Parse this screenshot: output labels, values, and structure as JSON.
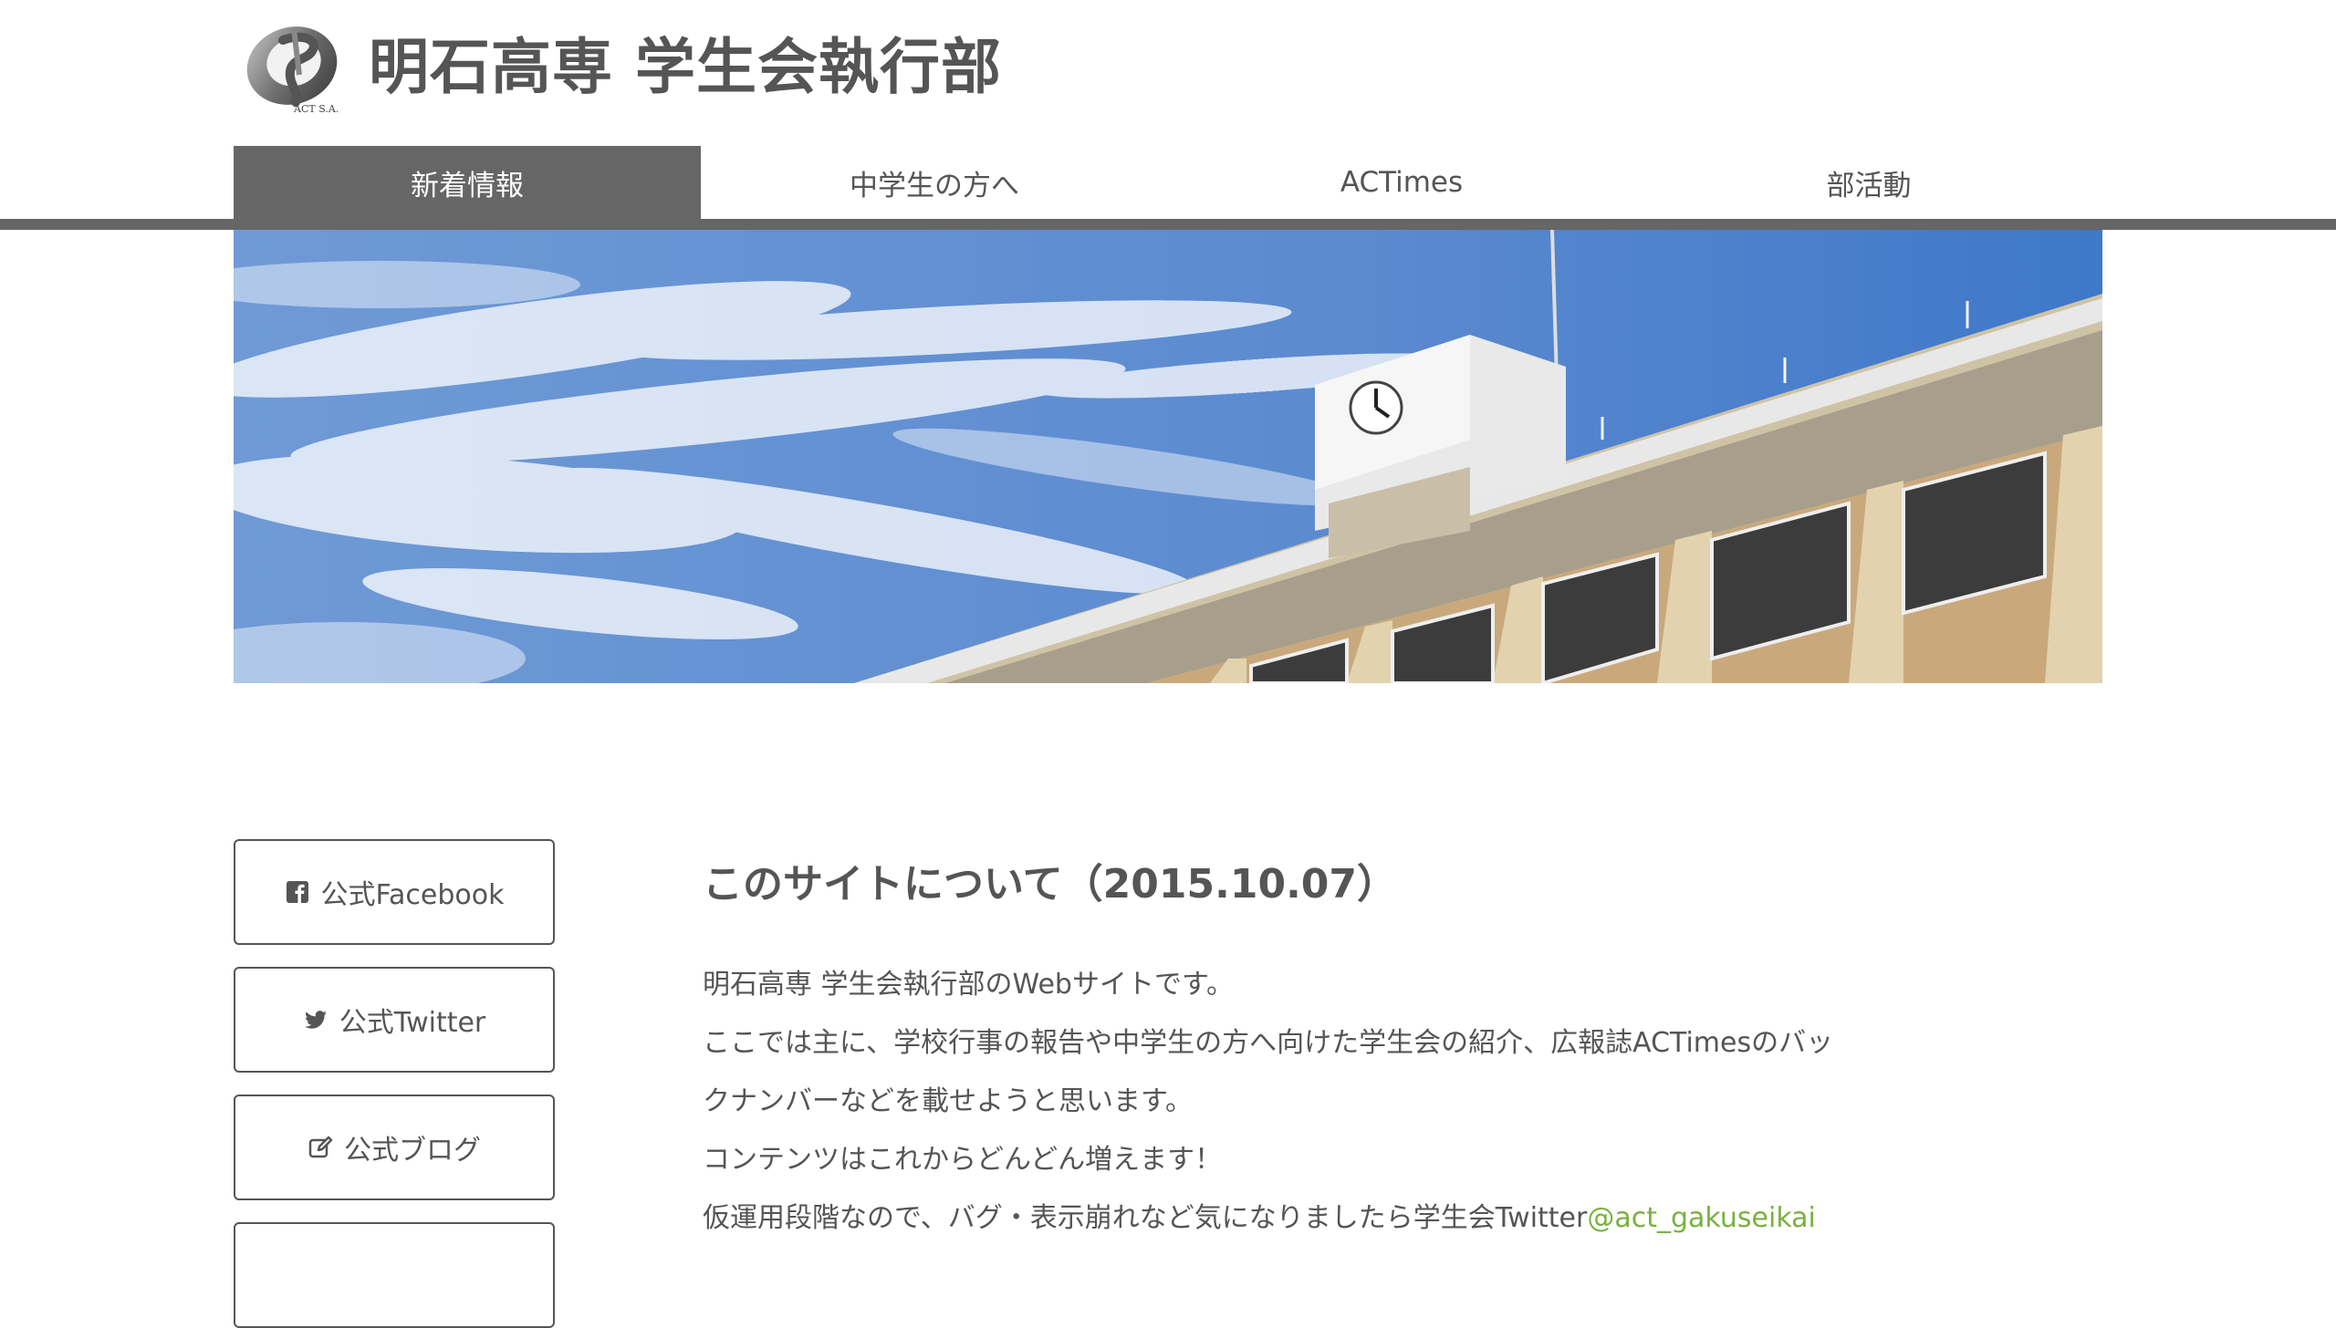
{
  "site": {
    "title": "明石高専 学生会執行部",
    "logo_text": "ACT S.A."
  },
  "nav": {
    "items": [
      {
        "label": "新着情報",
        "active": true
      },
      {
        "label": "中学生の方へ",
        "active": false
      },
      {
        "label": "ACTimes",
        "active": false
      },
      {
        "label": "部活動",
        "active": false
      }
    ]
  },
  "sidebar": {
    "buttons": [
      {
        "label": "公式Facebook",
        "icon": "facebook-icon"
      },
      {
        "label": "公式Twitter",
        "icon": "twitter-icon"
      },
      {
        "label": "公式ブログ",
        "icon": "edit-icon"
      }
    ]
  },
  "article": {
    "title": "このサイトについて（2015.10.07）",
    "lines": [
      "明石高専 学生会執行部のWebサイトです。",
      "ここでは主に、学校行事の報告や中学生の方へ向けた学生会の紹介、広報誌ACTimesのバッ",
      "クナンバーなどを載せようと思います。",
      "コンテンツはこれからどんどん増えます！",
      "仮運用段階なので、バグ・表示崩れなど気になりましたら学生会Twitter"
    ],
    "link_text": "@act_gakuseikai"
  },
  "colors": {
    "text": "#555555",
    "nav_active_bg": "#666666",
    "link": "#7ab040"
  }
}
